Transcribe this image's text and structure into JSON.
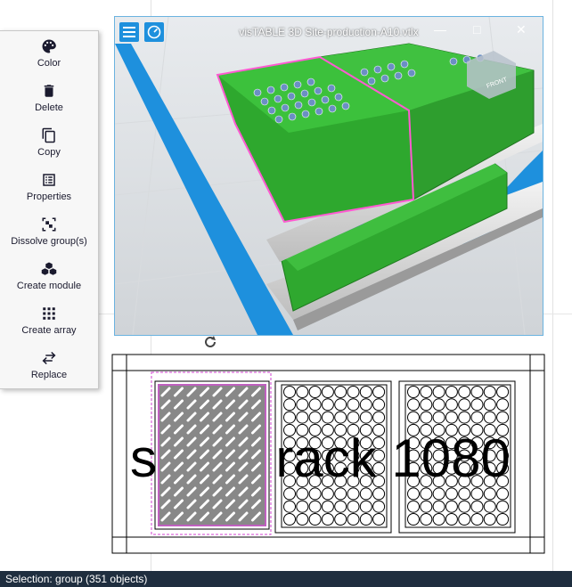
{
  "context_menu": {
    "items": [
      {
        "label": "Color",
        "icon": "palette-icon"
      },
      {
        "label": "Delete",
        "icon": "trash-icon"
      },
      {
        "label": "Copy",
        "icon": "copy-icon"
      },
      {
        "label": "Properties",
        "icon": "list-icon"
      },
      {
        "label": "Dissolve group(s)",
        "icon": "ungroup-icon"
      },
      {
        "label": "Create module",
        "icon": "cubes-icon"
      },
      {
        "label": "Create array",
        "icon": "grid-icon"
      },
      {
        "label": "Replace",
        "icon": "swap-icon"
      }
    ]
  },
  "viewer": {
    "title": "visTABLE 3D Site-production-A10.vtlx",
    "view_cube_label": "FRONT",
    "accent_color": "#1e90dd"
  },
  "drawing": {
    "label": "s        rack 1080"
  },
  "status": {
    "selection": "Selection:  group (351 objects)"
  }
}
